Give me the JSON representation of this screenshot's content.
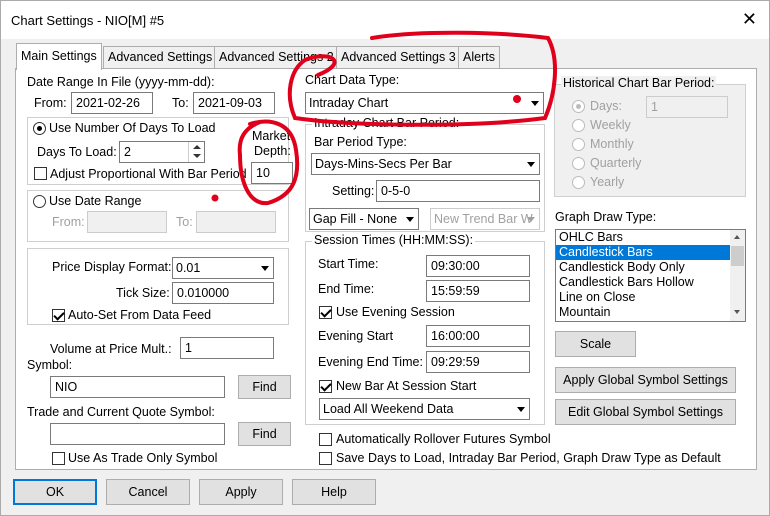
{
  "window": {
    "title": "Chart Settings - NIO[M]  #5"
  },
  "tabs": [
    "Main Settings",
    "Advanced Settings",
    "Advanced Settings 2",
    "Advanced Settings 3",
    "Alerts"
  ],
  "date_range": {
    "heading": "Date Range In File (yyyy-mm-dd):",
    "from_label": "From:",
    "from_value": "2021-02-26",
    "to_label": "To:",
    "to_value": "2021-09-03"
  },
  "days_group": {
    "use_days_label": "Use Number Of Days To Load",
    "days_to_load_label": "Days To Load:",
    "days_to_load_value": "2",
    "adjust_label": "Adjust Proportional With Bar Period",
    "market_depth_label_1": "Market",
    "market_depth_label_2": "Depth:",
    "market_depth_value": "10"
  },
  "date_range_group": {
    "use_date_range_label": "Use Date Range",
    "from_label": "From:",
    "to_label": "To:"
  },
  "price_group": {
    "price_format_label": "Price Display Format:",
    "price_format_value": "0.01",
    "tick_size_label": "Tick Size:",
    "tick_size_value": "0.010000",
    "auto_set_label": "Auto-Set From Data Feed"
  },
  "volume": {
    "label": "Volume at Price Mult.:",
    "value": "1"
  },
  "symbol": {
    "label": "Symbol:",
    "value": "NIO",
    "find_label": "Find"
  },
  "trade_symbol": {
    "label": "Trade and Current Quote Symbol:",
    "value": "",
    "find_label": "Find",
    "trade_only_label": "Use As Trade Only Symbol"
  },
  "chart_data_type": {
    "label": "Chart Data Type:",
    "value": "Intraday Chart"
  },
  "intraday_group": {
    "title": "Intraday Chart Bar Period:",
    "bar_period_type_label": "Bar Period Type:",
    "bar_period_type_value": "Days-Mins-Secs Per Bar",
    "setting_label": "Setting:",
    "setting_value": "0-5-0",
    "gap_fill_value": "Gap Fill - None",
    "new_trend_value": "New Trend Bar W"
  },
  "session_group": {
    "title": "Session Times (HH:MM:SS):",
    "start_label": "Start Time:",
    "start_value": "09:30:00",
    "end_label": "End Time:",
    "end_value": "15:59:59",
    "use_evening_label": "Use Evening Session",
    "evening_start_label": "Evening Start",
    "evening_start_value": "16:00:00",
    "evening_end_label": "Evening End Time:",
    "evening_end_value": "09:29:59",
    "new_bar_label": "New Bar At Session Start",
    "weekend_value": "Load All Weekend Data"
  },
  "rollover_label": "Automatically Rollover Futures Symbol",
  "save_default_label": "Save Days to Load, Intraday Bar Period, Graph Draw Type as Default",
  "historical_group": {
    "title": "Historical Chart Bar Period:",
    "days_label": "Days:",
    "days_value": "1",
    "options": [
      "Weekly",
      "Monthly",
      "Quarterly",
      "Yearly"
    ]
  },
  "graph_draw": {
    "label": "Graph Draw Type:",
    "items": [
      "OHLC Bars",
      "Candlestick Bars",
      "Candlestick Body Only",
      "Candlestick Bars Hollow",
      "Line on Close",
      "Mountain"
    ],
    "selected": "Candlestick Bars"
  },
  "buttons": {
    "scale": "Scale",
    "apply_global": "Apply Global Symbol Settings",
    "edit_global": "Edit Global Symbol Settings",
    "ok": "OK",
    "cancel": "Cancel",
    "apply": "Apply",
    "help": "Help"
  },
  "colors": {
    "accent": "#0078d7",
    "annotation": "#e0001b"
  }
}
